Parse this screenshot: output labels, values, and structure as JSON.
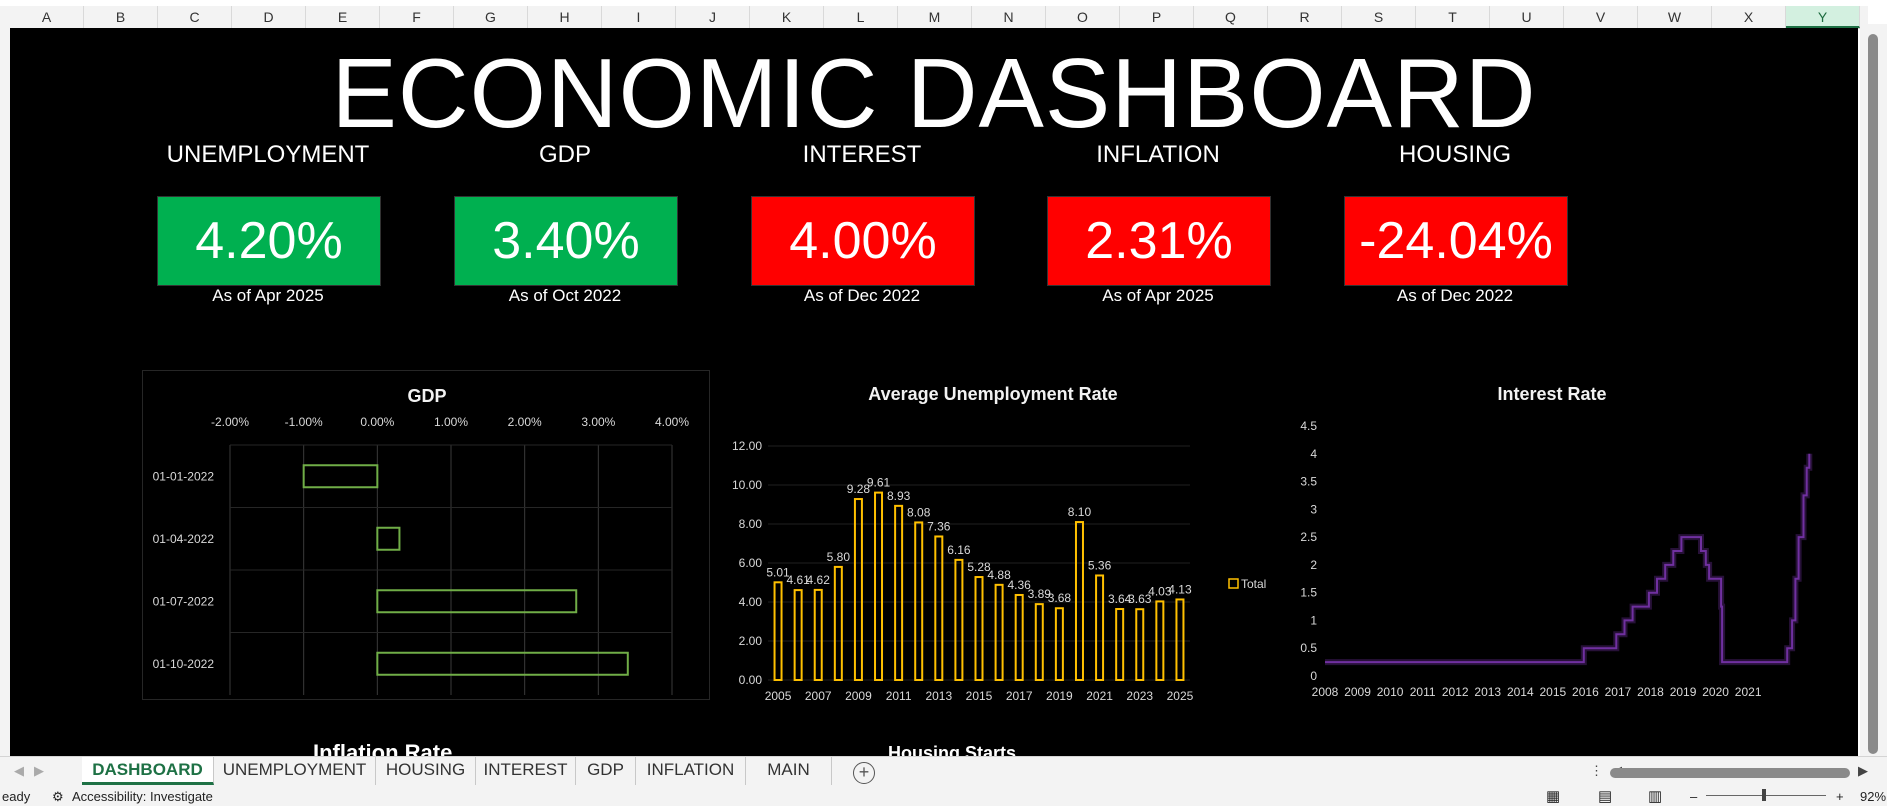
{
  "column_headers": [
    "A",
    "B",
    "C",
    "D",
    "E",
    "F",
    "G",
    "H",
    "I",
    "J",
    "K",
    "L",
    "M",
    "N",
    "O",
    "P",
    "Q",
    "R",
    "S",
    "T",
    "U",
    "V",
    "W",
    "X",
    "Y"
  ],
  "selected_column": "Y",
  "dashboard_title": "ECONOMIC DASHBOARD",
  "kpis": [
    {
      "label": "UNEMPLOYMENT",
      "value": "4.20%",
      "as_of": "As of Apr 2025",
      "color": "#00b050"
    },
    {
      "label": "GDP",
      "value": "3.40%",
      "as_of": "As of Oct 2022",
      "color": "#00b050"
    },
    {
      "label": "INTEREST",
      "value": "4.00%",
      "as_of": "As of Dec 2022",
      "color": "#ff0000"
    },
    {
      "label": "INFLATION",
      "value": "2.31%",
      "as_of": "As of Apr 2025",
      "color": "#ff0000"
    },
    {
      "label": "HOUSING",
      "value": "-24.04%",
      "as_of": "As of Dec 2022",
      "color": "#ff0000"
    }
  ],
  "chart_data": [
    {
      "type": "bar",
      "orientation": "horizontal",
      "title": "GDP",
      "categories": [
        "01-01-2022",
        "01-04-2022",
        "01-07-2022",
        "01-10-2022"
      ],
      "values": [
        -1.0,
        0.3,
        2.7,
        3.4
      ],
      "xlim": [
        -2.0,
        4.0
      ],
      "x_ticks": [
        "-2.00%",
        "-1.00%",
        "0.00%",
        "1.00%",
        "2.00%",
        "3.00%",
        "4.00%"
      ],
      "grid": true,
      "color": "#70ad47"
    },
    {
      "type": "bar",
      "title": "Average Unemployment Rate",
      "categories": [
        "2005",
        "2006",
        "2007",
        "2008",
        "2009",
        "2010",
        "2011",
        "2012",
        "2013",
        "2014",
        "2015",
        "2016",
        "2017",
        "2018",
        "2019",
        "2020",
        "2021",
        "2022",
        "2023",
        "2024",
        "2025"
      ],
      "x_tick_labels": [
        "2005",
        "2007",
        "2009",
        "2011",
        "2013",
        "2015",
        "2017",
        "2019",
        "2021",
        "2023",
        "2025"
      ],
      "series": [
        {
          "name": "Total",
          "values": [
            5.01,
            4.61,
            4.62,
            5.8,
            9.28,
            9.61,
            8.93,
            8.08,
            7.36,
            6.16,
            5.28,
            4.88,
            4.36,
            3.89,
            3.68,
            8.1,
            5.36,
            3.64,
            3.63,
            4.03,
            4.13
          ]
        }
      ],
      "data_labels": [
        "5.01",
        "4.61",
        "4.62",
        "5.80",
        "9.28",
        "9.61",
        "8.93",
        "8.08",
        "7.36",
        "6.16",
        "5.28",
        "4.88",
        "4.36",
        "3.89",
        "3.68",
        "8.10",
        "5.36",
        "3.64",
        "3.63",
        "4.03",
        "4.13"
      ],
      "ylim": [
        0,
        12
      ],
      "y_ticks": [
        "0.00",
        "2.00",
        "4.00",
        "6.00",
        "8.00",
        "10.00",
        "12.00"
      ],
      "legend": "right",
      "color": "#ffc000"
    },
    {
      "type": "line",
      "step": true,
      "title": "Interest Rate",
      "x_ticks": [
        "2008",
        "2009",
        "2010",
        "2011",
        "2012",
        "2013",
        "2014",
        "2015",
        "2016",
        "2017",
        "2018",
        "2019",
        "2020",
        "2021"
      ],
      "y_ticks": [
        "0",
        "0.5",
        "1",
        "1.5",
        "2",
        "2.5",
        "3",
        "3.5",
        "4",
        "4.5"
      ],
      "ylim": [
        0,
        4.5
      ],
      "xlim": [
        2008,
        2022.9
      ],
      "series": [
        {
          "values": [
            [
              2008.0,
              0.25
            ],
            [
              2015.95,
              0.25
            ],
            [
              2015.95,
              0.5
            ],
            [
              2016.95,
              0.5
            ],
            [
              2016.95,
              0.75
            ],
            [
              2017.2,
              0.75
            ],
            [
              2017.2,
              1.0
            ],
            [
              2017.45,
              1.0
            ],
            [
              2017.45,
              1.25
            ],
            [
              2017.95,
              1.25
            ],
            [
              2017.95,
              1.5
            ],
            [
              2018.2,
              1.5
            ],
            [
              2018.2,
              1.75
            ],
            [
              2018.45,
              1.75
            ],
            [
              2018.45,
              2.0
            ],
            [
              2018.7,
              2.0
            ],
            [
              2018.7,
              2.25
            ],
            [
              2018.95,
              2.25
            ],
            [
              2018.95,
              2.5
            ],
            [
              2019.55,
              2.5
            ],
            [
              2019.55,
              2.25
            ],
            [
              2019.7,
              2.25
            ],
            [
              2019.7,
              2.0
            ],
            [
              2019.8,
              2.0
            ],
            [
              2019.8,
              1.75
            ],
            [
              2020.17,
              1.75
            ],
            [
              2020.17,
              1.25
            ],
            [
              2020.2,
              1.25
            ],
            [
              2020.2,
              0.25
            ],
            [
              2022.2,
              0.25
            ],
            [
              2022.2,
              0.5
            ],
            [
              2022.35,
              0.5
            ],
            [
              2022.35,
              1.0
            ],
            [
              2022.45,
              1.0
            ],
            [
              2022.45,
              1.75
            ],
            [
              2022.55,
              1.75
            ],
            [
              2022.55,
              2.5
            ],
            [
              2022.7,
              2.5
            ],
            [
              2022.7,
              3.25
            ],
            [
              2022.8,
              3.25
            ],
            [
              2022.8,
              3.75
            ],
            [
              2022.88,
              3.75
            ],
            [
              2022.88,
              4.0
            ]
          ]
        }
      ],
      "color": "#7030a0"
    }
  ],
  "partial_chart_titles": [
    "Inflation Rate",
    "Housing Starts"
  ],
  "sheet_tabs": [
    "DASHBOARD",
    "UNEMPLOYMENT",
    "HOUSING",
    "INTEREST",
    "GDP",
    "INFLATION",
    "MAIN"
  ],
  "active_tab": "DASHBOARD",
  "add_sheet_symbol": "+",
  "status": {
    "ready": "eady",
    "accessibility": "Accessibility: Investigate",
    "zoom": "92%"
  }
}
